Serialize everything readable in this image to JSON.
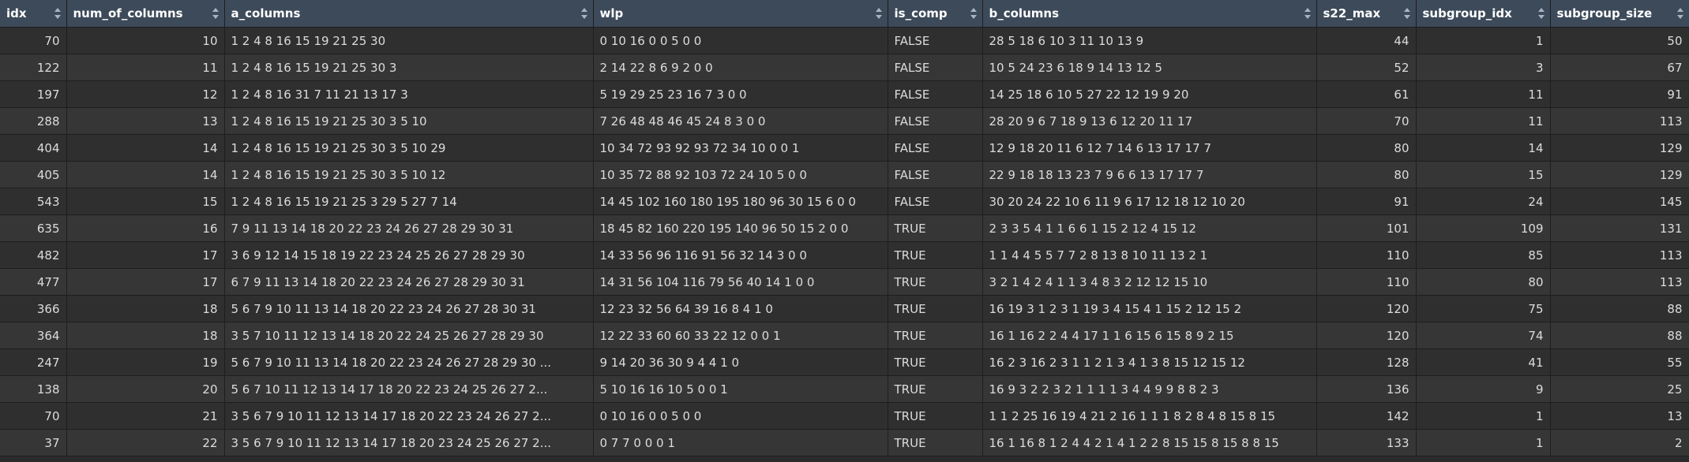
{
  "table": {
    "columns": [
      {
        "key": "idx",
        "label": "idx",
        "align": "num"
      },
      {
        "key": "num_of_columns",
        "label": "num_of_columns",
        "align": "num"
      },
      {
        "key": "a_columns",
        "label": "a_columns",
        "align": "txt"
      },
      {
        "key": "wlp",
        "label": "wlp",
        "align": "txt"
      },
      {
        "key": "is_comp",
        "label": "is_comp",
        "align": "txt"
      },
      {
        "key": "b_columns",
        "label": "b_columns",
        "align": "txt"
      },
      {
        "key": "s22_max",
        "label": "s22_max",
        "align": "num"
      },
      {
        "key": "subgroup_idx",
        "label": "subgroup_idx",
        "align": "num"
      },
      {
        "key": "subgroup_size",
        "label": "subgroup_size",
        "align": "num"
      }
    ],
    "rows": [
      [
        "70",
        "10",
        "1 2 4 8 16 15 19 21 25 30",
        "0 10 16 0 0 5 0 0",
        "FALSE",
        "28 5 18 6 10 3 11 10 13 9",
        "44",
        "1",
        "50"
      ],
      [
        "122",
        "11",
        "1 2 4 8 16 15 19 21 25 30 3",
        "2 14 22 8 6 9 2 0 0",
        "FALSE",
        "10 5 24 23 6 18 9 14 13 12 5",
        "52",
        "3",
        "67"
      ],
      [
        "197",
        "12",
        "1 2 4 8 16 31 7 11 21 13 17 3",
        "5 19 29 25 23 16 7 3 0 0",
        "FALSE",
        "14 25 18 6 10 5 27 22 12 19 9 20",
        "61",
        "11",
        "91"
      ],
      [
        "288",
        "13",
        "1 2 4 8 16 15 19 21 25 30 3 5 10",
        "7 26 48 48 46 45 24 8 3 0 0",
        "FALSE",
        "28 20 9 6 7 18 9 13 6 12 20 11 17",
        "70",
        "11",
        "113"
      ],
      [
        "404",
        "14",
        "1 2 4 8 16 15 19 21 25 30 3 5 10 29",
        "10 34 72 93 92 93 72 34 10 0 0 1",
        "FALSE",
        "12 9 18 20 11 6 12 7 14 6 13 17 17 7",
        "80",
        "14",
        "129"
      ],
      [
        "405",
        "14",
        "1 2 4 8 16 15 19 21 25 30 3 5 10 12",
        "10 35 72 88 92 103 72 24 10 5 0 0",
        "FALSE",
        "22 9 18 18 13 23 7 9 6 6 13 17 17 7",
        "80",
        "15",
        "129"
      ],
      [
        "543",
        "15",
        "1 2 4 8 16 15 19 21 25 3 29 5 27 7 14",
        "14 45 102 160 180 195 180 96 30 15 6 0 0",
        "FALSE",
        "30 20 24 22 10 6 11 9 6 17 12 18 12 10 20",
        "91",
        "24",
        "145"
      ],
      [
        "635",
        "16",
        "7 9 11 13 14 18 20 22 23 24 26 27 28 29 30 31",
        "18 45 82 160 220 195 140 96 50 15 2 0 0",
        "TRUE",
        "2 3 3 5 4 1 1 6 6 1 15 2 12 4 15 12",
        "101",
        "109",
        "131"
      ],
      [
        "482",
        "17",
        "3 6 9 12 14 15 18 19 22 23 24 25 26 27 28 29 30",
        "14 33 56 96 116 91 56 32 14 3 0 0",
        "TRUE",
        "1 1 4 4 5 5 7 7 2 8 13 8 10 11 13 2 1",
        "110",
        "85",
        "113"
      ],
      [
        "477",
        "17",
        "6 7 9 11 13 14 18 20 22 23 24 26 27 28 29 30 31",
        "14 31 56 104 116 79 56 40 14 1 0 0",
        "TRUE",
        "3 2 1 4 2 4 1 1 3 4 8 3 2 12 12 15 10",
        "110",
        "80",
        "113"
      ],
      [
        "366",
        "18",
        "5 6 7 9 10 11 13 14 18 20 22 23 24 26 27 28 30 31",
        "12 23 32 56 64 39 16 8 4 1 0",
        "TRUE",
        "16 19 3 1 2 3 1 19 3 4 15 4 1 15 2 12 15 2",
        "120",
        "75",
        "88"
      ],
      [
        "364",
        "18",
        "3 5 7 10 11 12 13 14 18 20 22 24 25 26 27 28 29 30",
        "12 22 33 60 60 33 22 12 0 0 1",
        "TRUE",
        "16 1 16 2 2 4 4 17 1 1 6 15 6 15 8 9 2 15",
        "120",
        "74",
        "88"
      ],
      [
        "247",
        "19",
        "5 6 7 9 10 11 13 14 18 20 22 23 24 26 27 28 29 30 ...",
        "9 14 20 36 30 9 4 4 1 0",
        "TRUE",
        "16 2 3 16 2 3 1 1 2 1 3 4 1 3 8 15 12 15 12",
        "128",
        "41",
        "55"
      ],
      [
        "138",
        "20",
        "5 6 7 10 11 12 13 14 17 18 20 22 23 24 25 26 27 2...",
        "5 10 16 16 10 5 0 0 1",
        "TRUE",
        "16 9 3 2 2 3 2 1 1 1 1 3 4 4 9 9 8 8 2 3",
        "136",
        "9",
        "25"
      ],
      [
        "70",
        "21",
        "3 5 6 7 9 10 11 12 13 14 17 18 20 22 23 24 26 27 2...",
        "0 10 16 0 0 5 0 0",
        "TRUE",
        "1 1 2 25 16 19 4 21 2 16 1 1 1 8 2 8 4 8 15 8 15",
        "142",
        "1",
        "13"
      ],
      [
        "37",
        "22",
        "3 5 6 7 9 10 11 12 13 14 17 18 20 23 24 25 26 27 2...",
        "0 7 7 0 0 0 1",
        "TRUE",
        "16 1 16 8 1 2 4 4 2 1 4 1 2 2 8 15 15 8 15 8 8 15",
        "133",
        "1",
        "2"
      ]
    ]
  },
  "colors": {
    "header_bg": "#3d4a5a",
    "row_odd": "#2f2f2f",
    "row_even": "#363636",
    "text": "#dcdcdc"
  },
  "icons": {
    "sort": "sort-arrows-icon"
  }
}
